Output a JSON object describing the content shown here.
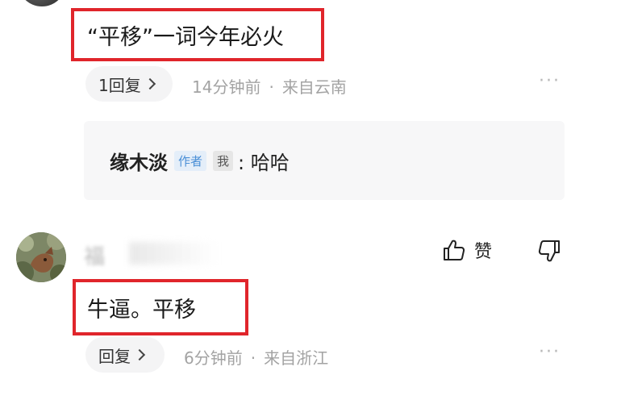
{
  "comment1": {
    "text": "“平移”一词今年必火",
    "reply_count_label": "1回复",
    "time": "14分钟前",
    "separator": "·",
    "location": "来自云南",
    "more": "···"
  },
  "subreply": {
    "author": "缘木淡",
    "author_tag": "作者",
    "me_tag": "我",
    "text": ": 哈哈"
  },
  "comment2": {
    "username": "福",
    "like_label": "赞",
    "text": "牛逼。平移",
    "reply_label": "回复",
    "time": "6分钟前",
    "separator": "·",
    "location": "来自浙江",
    "more": "···"
  },
  "colors": {
    "highlight_red": "#e0252b",
    "author_tag_blue": "#4a8fd6"
  },
  "icons": [
    "thumbs-up-icon",
    "thumbs-down-icon",
    "chevron-right-icon",
    "more-icon"
  ]
}
